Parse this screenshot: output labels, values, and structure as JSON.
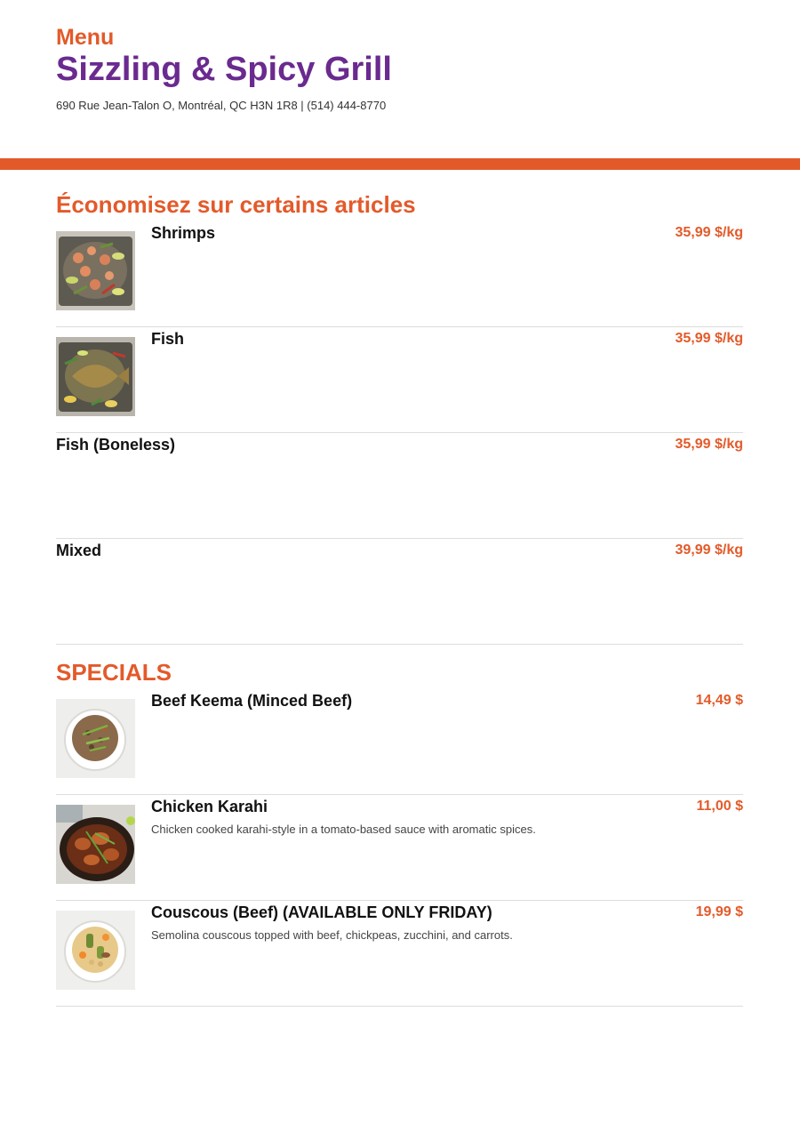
{
  "header": {
    "menu_label": "Menu",
    "restaurant_name": "Sizzling & Spicy Grill",
    "address_line": "690 Rue Jean-Talon O, Montréal, QC H3N 1R8 | (514) 444-8770"
  },
  "colors": {
    "accent": "#e35a2a",
    "brand": "#6a2a8f"
  },
  "sections": [
    {
      "title": "Économisez sur certains articles",
      "items": [
        {
          "name": "Shrimps",
          "price": "35,99 $/kg",
          "description": "",
          "image": "shrimps-platter-photo"
        },
        {
          "name": "Fish",
          "price": "35,99 $/kg",
          "description": "",
          "image": "fish-platter-photo"
        },
        {
          "name": "Fish (Boneless)",
          "price": "35,99 $/kg",
          "description": ""
        },
        {
          "name": "Mixed",
          "price": "39,99 $/kg",
          "description": ""
        }
      ]
    },
    {
      "title": "SPECIALS",
      "items": [
        {
          "name": "Beef Keema (Minced Beef)",
          "price": "14,49 $",
          "description": "",
          "image": "beef-keema-bowl-photo"
        },
        {
          "name": "Chicken Karahi",
          "price": "11,00 $",
          "description": "Chicken cooked karahi-style in a tomato-based sauce with aromatic spices.",
          "image": "chicken-karahi-pan-photo"
        },
        {
          "name": "Couscous (Beef) (AVAILABLE ONLY FRIDAY)",
          "price": "19,99 $",
          "description": "Semolina couscous topped with beef, chickpeas, zucchini, and carrots.",
          "image": "couscous-bowl-photo"
        }
      ]
    }
  ]
}
